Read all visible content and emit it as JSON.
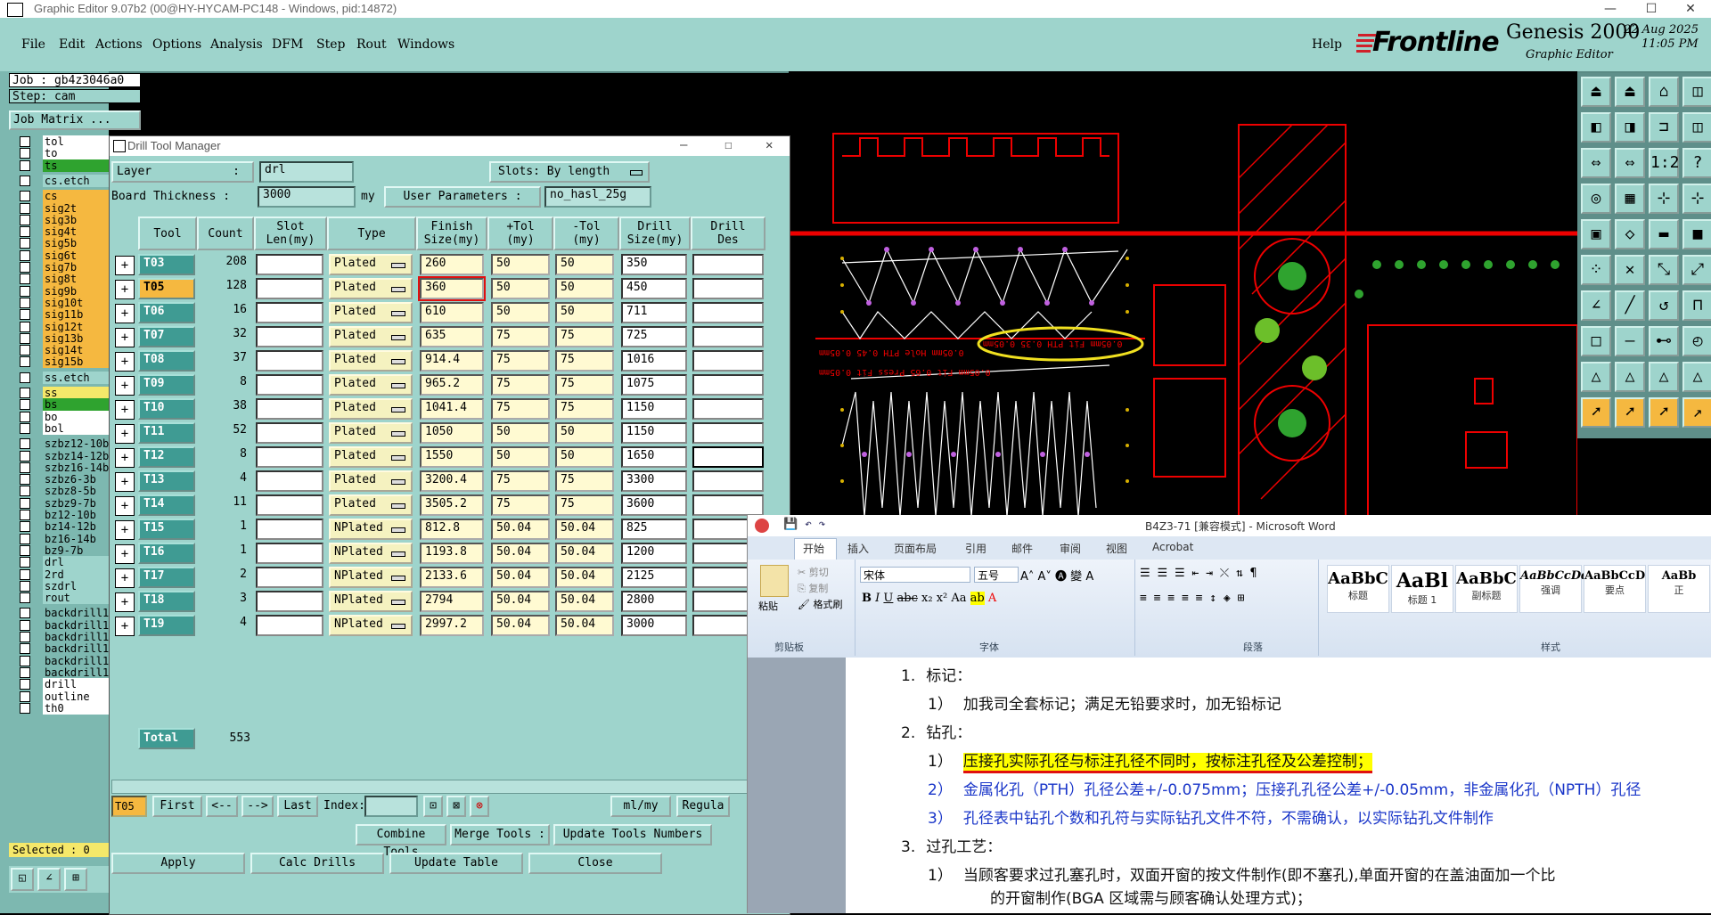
{
  "window": {
    "title": "Graphic Editor 9.07b2 (00@HY-HYCAM-PC148 - Windows, pid:14872)"
  },
  "menu": [
    "File",
    "Edit",
    "Actions",
    "Options",
    "Analysis",
    "DFM",
    "Step",
    "Rout",
    "Windows"
  ],
  "help": "Help",
  "brand": {
    "logo": "Frontline",
    "product": "Genesis 2000",
    "sub": "Graphic Editor",
    "date": "22 Aug 2025",
    "time": "11:05 PM"
  },
  "left": {
    "job": "Job : gb4z3046a0",
    "step": "Step: cam",
    "job_matrix": "Job Matrix ...",
    "layers": [
      "tol",
      "to",
      "ts",
      "cs.etch",
      "cs",
      "sig2t",
      "sig3b",
      "sig4t",
      "sig5b",
      "sig6t",
      "sig7b",
      "sig8t",
      "sig9b",
      "sig10t",
      "sig11b",
      "sig12t",
      "sig13b",
      "sig14t",
      "sig15b",
      "ss.etch",
      "ss",
      "bs",
      "bo",
      "bol",
      "szbz12-10b",
      "szbz14-12b",
      "szbz16-14b",
      "szbz6-3b",
      "szbz8-5b",
      "szbz9-7b",
      "bz12-10b",
      "bz14-12b",
      "bz16-14b",
      "bz9-7b",
      "drl",
      "2rd",
      "szdrl",
      "rout",
      "backdrill11",
      "backdrill11",
      "backdrill11",
      "backdrill11",
      "backdrill11",
      "backdrill11",
      "drill",
      "outline",
      "th0"
    ],
    "selected": "Selected : 0"
  },
  "dtm": {
    "title": "Drill Tool Manager",
    "layer_label": "Layer",
    "layer_value": "drl",
    "slots_label": "Slots:",
    "slots_value": "By length",
    "board_label": "Board Thickness :",
    "board_value": "3000",
    "board_unit": "my",
    "user_params_label": "User Parameters :",
    "user_params_value": "no_hasl_25g",
    "headers": {
      "tool": "Tool",
      "count": "Count",
      "slot": "Slot\nLen(my)",
      "type": "Type",
      "finish": "Finish\nSize(my)",
      "ptol": "+Tol\n(my)",
      "mtol": "-Tol\n(my)",
      "drill": "Drill\nSize(my)",
      "des": "Drill\nDes"
    },
    "rows": [
      {
        "tool": "T03",
        "count": "208",
        "type": "Plated",
        "finish": "260",
        "ptol": "50",
        "mtol": "50",
        "drill": "350"
      },
      {
        "tool": "T05",
        "count": "128",
        "type": "Plated",
        "finish": "360",
        "ptol": "50",
        "mtol": "50",
        "drill": "450"
      },
      {
        "tool": "T06",
        "count": "16",
        "type": "Plated",
        "finish": "610",
        "ptol": "50",
        "mtol": "50",
        "drill": "711"
      },
      {
        "tool": "T07",
        "count": "32",
        "type": "Plated",
        "finish": "635",
        "ptol": "75",
        "mtol": "75",
        "drill": "725"
      },
      {
        "tool": "T08",
        "count": "37",
        "type": "Plated",
        "finish": "914.4",
        "ptol": "75",
        "mtol": "75",
        "drill": "1016"
      },
      {
        "tool": "T09",
        "count": "8",
        "type": "Plated",
        "finish": "965.2",
        "ptol": "75",
        "mtol": "75",
        "drill": "1075"
      },
      {
        "tool": "T10",
        "count": "38",
        "type": "Plated",
        "finish": "1041.4",
        "ptol": "75",
        "mtol": "75",
        "drill": "1150"
      },
      {
        "tool": "T11",
        "count": "52",
        "type": "Plated",
        "finish": "1050",
        "ptol": "50",
        "mtol": "50",
        "drill": "1150"
      },
      {
        "tool": "T12",
        "count": "8",
        "type": "Plated",
        "finish": "1550",
        "ptol": "50",
        "mtol": "50",
        "drill": "1650"
      },
      {
        "tool": "T13",
        "count": "4",
        "type": "Plated",
        "finish": "3200.4",
        "ptol": "75",
        "mtol": "75",
        "drill": "3300"
      },
      {
        "tool": "T14",
        "count": "11",
        "type": "Plated",
        "finish": "3505.2",
        "ptol": "75",
        "mtol": "75",
        "drill": "3600"
      },
      {
        "tool": "T15",
        "count": "1",
        "type": "NPlated",
        "finish": "812.8",
        "ptol": "50.04",
        "mtol": "50.04",
        "drill": "825"
      },
      {
        "tool": "T16",
        "count": "1",
        "type": "NPlated",
        "finish": "1193.8",
        "ptol": "50.04",
        "mtol": "50.04",
        "drill": "1200"
      },
      {
        "tool": "T17",
        "count": "2",
        "type": "NPlated",
        "finish": "2133.6",
        "ptol": "50.04",
        "mtol": "50.04",
        "drill": "2125"
      },
      {
        "tool": "T18",
        "count": "3",
        "type": "NPlated",
        "finish": "2794",
        "ptol": "50.04",
        "mtol": "50.04",
        "drill": "2800"
      },
      {
        "tool": "T19",
        "count": "4",
        "type": "NPlated",
        "finish": "2997.2",
        "ptol": "50.04",
        "mtol": "50.04",
        "drill": "3000"
      }
    ],
    "total_label": "Total",
    "total_value": "553",
    "current_tool": "T05",
    "nav": {
      "first": "First",
      "prev": "<--",
      "next": "-->",
      "last": "Last",
      "index": "Index:",
      "unit": "ml/my",
      "regular": "Regula"
    },
    "buttons": {
      "combine": "Combine Tools",
      "merge": "Merge Tools :",
      "update_numbers": "Update Tools Numbers",
      "apply": "Apply",
      "calc": "Calc Drills",
      "update_table": "Update Table",
      "close": "Close"
    }
  },
  "canvas": {
    "annotation1": "0.05mm Hole PTH 0.45 0.05mm",
    "annotation2": "0.05mm Fit PTH 0.35 0.05mm",
    "annotation3": "0.05mm Fit 0.65 Press Fit 0.05mm"
  },
  "word": {
    "title": "B4Z3-71 [兼容模式] - Microsoft Word",
    "tabs": [
      "开始",
      "插入",
      "页面布局",
      "引用",
      "邮件",
      "审阅",
      "视图",
      "Acrobat"
    ],
    "clipboard": {
      "paste": "粘贴",
      "cut": "剪切",
      "copy": "复制",
      "painter": "格式刷",
      "group": "剪贴板"
    },
    "font": {
      "name": "宋体",
      "size": "五号",
      "group": "字体"
    },
    "para_group": "段落",
    "styles_group": "样式",
    "styles": [
      {
        "preview": "AaBbC",
        "name": "标题"
      },
      {
        "preview": "AaBl",
        "name": "标题 1"
      },
      {
        "preview": "AaBbC",
        "name": "副标题"
      },
      {
        "preview": "AaBbCcDd",
        "name": "强调"
      },
      {
        "preview": "AaBbCcD",
        "name": "要点"
      },
      {
        "preview": "AaBb",
        "name": "正"
      }
    ],
    "doc": [
      {
        "num": "1.",
        "text": "标记："
      },
      {
        "num": "1）",
        "text": "加我司全套标记；满足无铅要求时，加无铅标记"
      },
      {
        "num": "2.",
        "text": "钻孔："
      },
      {
        "num": "1）",
        "text": "压接孔实际孔径与标注孔径不同时，按标注孔径及公差控制；"
      },
      {
        "num": "2）",
        "text": "金属化孔（PTH）孔径公差+/-0.075mm；压接孔孔径公差+/-0.05mm，非金属化孔（NPTH）孔径"
      },
      {
        "num": "3）",
        "text": "孔径表中钻孔个数和孔符与实际钻孔文件不符，不需确认，以实际钻孔文件制作"
      },
      {
        "num": "3.",
        "text": "过孔工艺："
      },
      {
        "num": "1）",
        "text": "当顾客要求过孔塞孔时，双面开窗的按文件制作(即不塞孔),单面开窗的在盖油面加一个比"
      },
      {
        "num": "",
        "text": "的开窗制作(BGA 区域需与顾客确认处理方式)；"
      }
    ]
  }
}
